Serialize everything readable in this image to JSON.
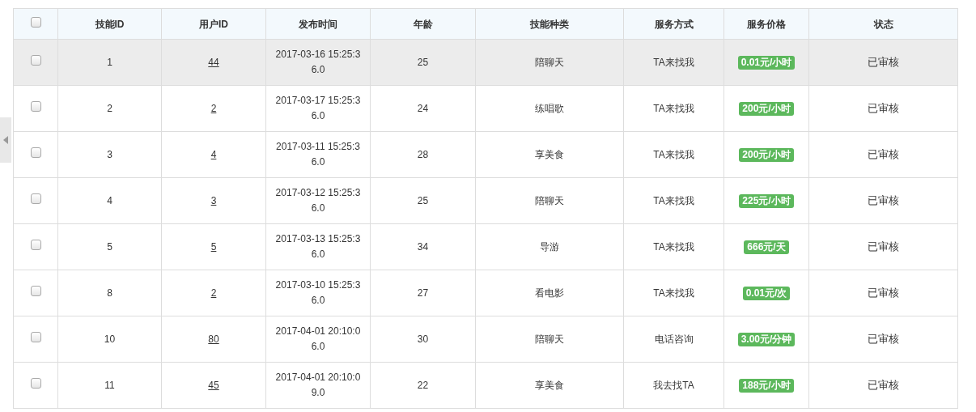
{
  "table": {
    "all_checked": false,
    "columns": [
      "技能ID",
      "用户ID",
      "发布时间",
      "年龄",
      "技能种类",
      "服务方式",
      "服务价格",
      "状态"
    ],
    "rows": [
      {
        "checked": false,
        "selected": true,
        "skill_id": "1",
        "user_id": "44",
        "time": "2017-03-16 15:25:36.0",
        "age": "25",
        "kind": "陪聊天",
        "mode": "TA来找我",
        "price": "0.01元/小时",
        "status": "已审核"
      },
      {
        "checked": false,
        "selected": false,
        "skill_id": "2",
        "user_id": "2",
        "time": "2017-03-17 15:25:36.0",
        "age": "24",
        "kind": "练唱歌",
        "mode": "TA来找我",
        "price": "200元/小时",
        "status": "已审核"
      },
      {
        "checked": false,
        "selected": false,
        "skill_id": "3",
        "user_id": "4",
        "time": "2017-03-11 15:25:36.0",
        "age": "28",
        "kind": "享美食",
        "mode": "TA来找我",
        "price": "200元/小时",
        "status": "已审核"
      },
      {
        "checked": false,
        "selected": false,
        "skill_id": "4",
        "user_id": "3",
        "time": "2017-03-12 15:25:36.0",
        "age": "25",
        "kind": "陪聊天",
        "mode": "TA来找我",
        "price": "225元/小时",
        "status": "已审核"
      },
      {
        "checked": false,
        "selected": false,
        "skill_id": "5",
        "user_id": "5",
        "time": "2017-03-13 15:25:36.0",
        "age": "34",
        "kind": "导游",
        "mode": "TA来找我",
        "price": "666元/天",
        "status": "已审核"
      },
      {
        "checked": false,
        "selected": false,
        "skill_id": "8",
        "user_id": "2",
        "time": "2017-03-10 15:25:36.0",
        "age": "27",
        "kind": "看电影",
        "mode": "TA来找我",
        "price": "0.01元/次",
        "status": "已审核"
      },
      {
        "checked": false,
        "selected": false,
        "skill_id": "10",
        "user_id": "80",
        "time": "2017-04-01 20:10:06.0",
        "age": "30",
        "kind": "陪聊天",
        "mode": "电话咨询",
        "price": "3.00元/分钟",
        "status": "已审核"
      },
      {
        "checked": false,
        "selected": false,
        "skill_id": "11",
        "user_id": "45",
        "time": "2017-04-01 20:10:09.0",
        "age": "22",
        "kind": "享美食",
        "mode": "我去找TA",
        "price": "188元/小时",
        "status": "已审核"
      }
    ]
  }
}
